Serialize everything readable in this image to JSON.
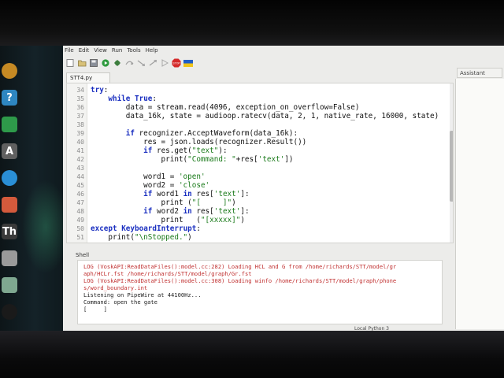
{
  "menu": [
    "File",
    "Edit",
    "View",
    "Run",
    "Tools",
    "Help"
  ],
  "toolbar": {
    "icons": [
      "new-file-icon",
      "open-file-icon",
      "save-icon",
      "run-icon",
      "debug-icon",
      "step-over-icon",
      "step-into-icon",
      "step-out-icon",
      "resume-icon",
      "stop-icon",
      "flag-icon"
    ],
    "stop_label": "STOP"
  },
  "editor": {
    "tab": "STT4.py",
    "lines": [
      {
        "n": "34",
        "code": "try:"
      },
      {
        "n": "35",
        "code": "    while True:"
      },
      {
        "n": "36",
        "code": "        data = stream.read(4096, exception_on_overflow=False)"
      },
      {
        "n": "37",
        "code": "        data_16k, state = audioop.ratecv(data, 2, 1, native_rate, 16000, state)"
      },
      {
        "n": "38",
        "code": ""
      },
      {
        "n": "39",
        "code": "        if recognizer.AcceptWaveform(data_16k):"
      },
      {
        "n": "40",
        "code": "            res = json.loads(recognizer.Result())"
      },
      {
        "n": "41",
        "code": "            if res.get(\"text\"):"
      },
      {
        "n": "42",
        "code": "                print(\"Command: \"+res['text'])"
      },
      {
        "n": "43",
        "code": ""
      },
      {
        "n": "44",
        "code": "            word1 = 'open'"
      },
      {
        "n": "45",
        "code": "            word2 = 'close'"
      },
      {
        "n": "46",
        "code": "            if word1 in res['text']:"
      },
      {
        "n": "47",
        "code": "                print (\"[     ]\")"
      },
      {
        "n": "48",
        "code": "            if word2 in res['text']:"
      },
      {
        "n": "49",
        "code": "                print   (\"[xxxxx]\")"
      },
      {
        "n": "50",
        "code": "except KeyboardInterrupt:"
      },
      {
        "n": "51",
        "code": "    print(\"\\nStopped.\")"
      }
    ]
  },
  "shell": {
    "label": "Shell",
    "lines": [
      {
        "kind": "log",
        "text": "LOG (VoskAPI:ReadDataFiles():model.cc:282) Loading HCL and G from /home/richards/STT/model/gr"
      },
      {
        "kind": "log",
        "text": "aph/HCLr.fst /home/richards/STT/model/graph/Gr.fst"
      },
      {
        "kind": "log",
        "text": "LOG (VoskAPI:ReadDataFiles():model.cc:308) Loading winfo /home/richards/STT/model/graph/phone"
      },
      {
        "kind": "log",
        "text": "s/word_boundary.int"
      },
      {
        "kind": "out",
        "text": "Listening on PipeWire at 44100Hz..."
      },
      {
        "kind": "out",
        "text": "Command: open the gate"
      },
      {
        "kind": "out",
        "text": "[     ]"
      }
    ]
  },
  "assistant": {
    "tab": "Assistant"
  },
  "status": {
    "text": "Local Python 3"
  },
  "dock": [
    {
      "name": "dock-app-icon",
      "glyph": "",
      "color": "#c68a24"
    },
    {
      "name": "dock-help-icon",
      "glyph": "?",
      "color": "#2e86c1"
    },
    {
      "name": "dock-spreadsheet-icon",
      "glyph": "",
      "color": "#2e9a4a"
    },
    {
      "name": "dock-accessibility-icon",
      "glyph": "A",
      "color": "#606060"
    },
    {
      "name": "dock-browser-icon",
      "glyph": "",
      "color": "#2a8fd6"
    },
    {
      "name": "dock-software-icon",
      "glyph": "",
      "color": "#d45a3c"
    },
    {
      "name": "dock-thonny-icon",
      "glyph": "Th",
      "color": "#3a3a3a"
    },
    {
      "name": "dock-drive-icon",
      "glyph": "",
      "color": "#9a9a9a"
    },
    {
      "name": "dock-trash-icon",
      "glyph": "",
      "color": "#7fa890"
    },
    {
      "name": "dock-show-apps-icon",
      "glyph": "",
      "color": "#1a1a1a"
    }
  ]
}
